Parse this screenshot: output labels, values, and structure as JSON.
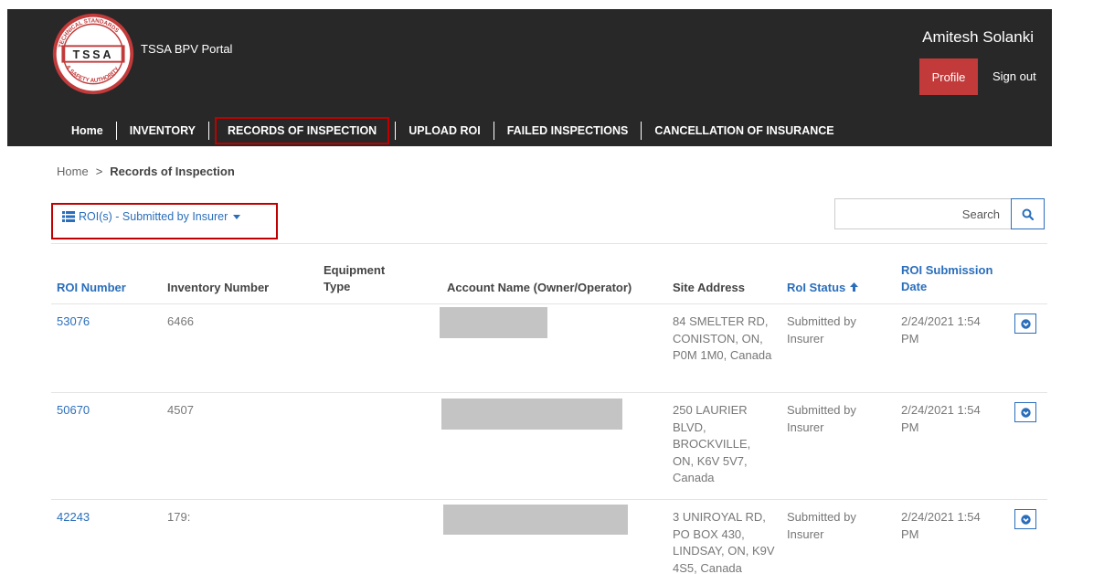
{
  "header": {
    "logo_text": "TSSA",
    "logo_ring_text": "TECHNICAL STANDARDS & SAFETY AUTHORITY",
    "portal_title": "TSSA BPV Portal",
    "user_name": "Amitesh Solanki",
    "profile_label": "Profile",
    "signout_label": "Sign out",
    "colors": {
      "bg": "#282828",
      "profile_btn": "#c23a3a",
      "highlight": "#c00000"
    }
  },
  "nav": {
    "items": [
      {
        "label": "Home"
      },
      {
        "label": "INVENTORY"
      },
      {
        "label": "RECORDS OF INSPECTION"
      },
      {
        "label": "UPLOAD ROI"
      },
      {
        "label": "FAILED INSPECTIONS"
      },
      {
        "label": "CANCELLATION OF INSURANCE"
      }
    ],
    "active": "RECORDS OF INSPECTION"
  },
  "breadcrumb": {
    "home": "Home",
    "separator": ">",
    "current": "Records of Inspection"
  },
  "filter": {
    "label": "ROI(s) - Submitted by Insurer",
    "icon": "list-icon"
  },
  "search": {
    "placeholder": "Search",
    "icon": "search-icon"
  },
  "table": {
    "columns": [
      {
        "label": "ROI Number",
        "sortable": true
      },
      {
        "label": "Inventory Number",
        "sortable": false
      },
      {
        "label": "Equipment Type",
        "sortable": false
      },
      {
        "label": "Account Name (Owner/Operator)",
        "sortable": false
      },
      {
        "label": "Site Address",
        "sortable": false
      },
      {
        "label": "RoI Status",
        "sortable": true,
        "sorted": "asc"
      },
      {
        "label": "ROI Submission Date",
        "sortable": true
      }
    ],
    "rows": [
      {
        "roi_number": "53076",
        "inventory_number": "6466",
        "equipment_type": "",
        "site_address": "84 SMELTER RD, CONISTON, ON, P0M 1M0, Canada",
        "status": "Submitted by Insurer",
        "submission_date": "2/24/2021 1:54 PM"
      },
      {
        "roi_number": "50670",
        "inventory_number": "4507",
        "equipment_type": "",
        "site_address": "250 LAURIER BLVD, BROCKVILLE, ON, K6V 5V7, Canada",
        "status": "Submitted by Insurer",
        "submission_date": "2/24/2021 1:54 PM"
      },
      {
        "roi_number": "42243",
        "inventory_number": "179:",
        "equipment_type": "",
        "site_address": "3 UNIROYAL RD, PO BOX 430, LINDSAY, ON, K9V 4S5, Canada",
        "status": "Submitted by Insurer",
        "submission_date": "2/24/2021 1:54 PM"
      }
    ]
  }
}
